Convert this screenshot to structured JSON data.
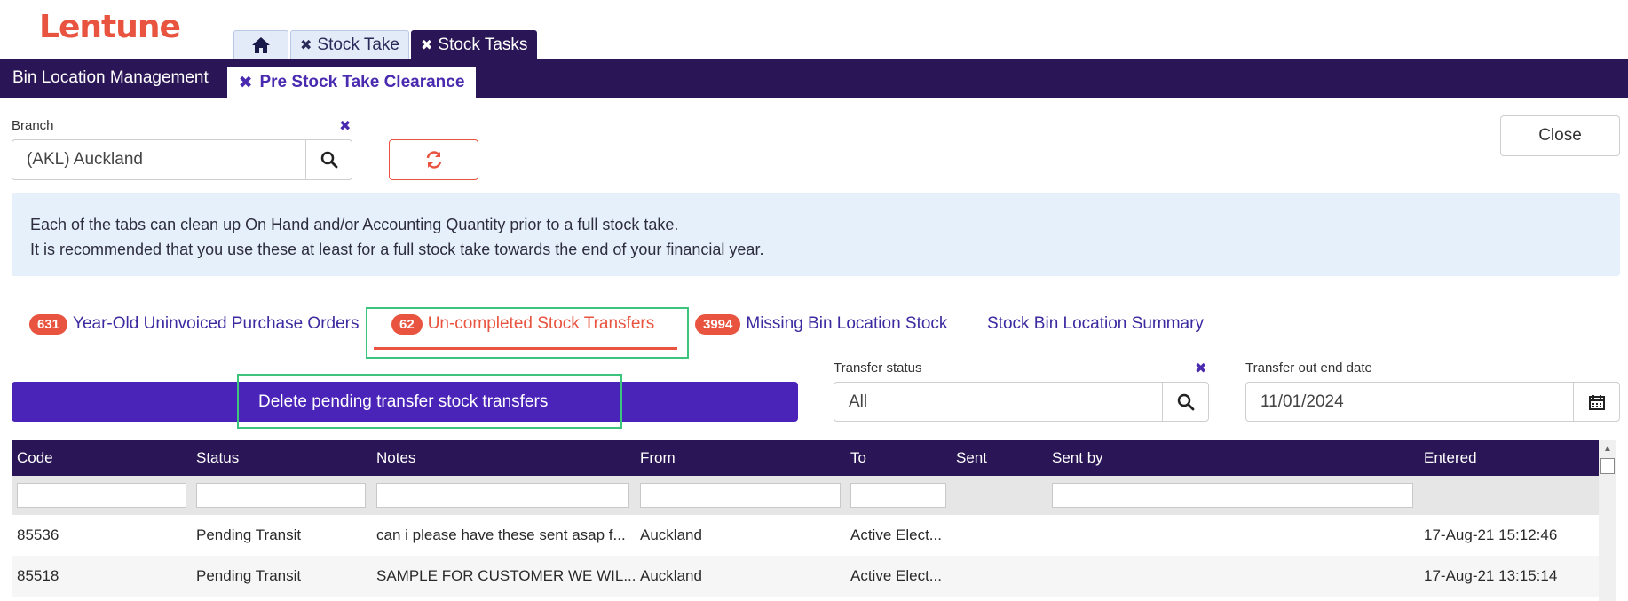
{
  "app": {
    "logo": "Lentune"
  },
  "app_tabs": [
    {
      "label": "",
      "icon": "home-icon"
    },
    {
      "label": "Stock Take",
      "closable": true
    },
    {
      "label": "Stock Tasks",
      "closable": true,
      "active": true
    }
  ],
  "sub_tabs": {
    "bin_location": "Bin Location Management",
    "pre_stock": "Pre Stock Take Clearance"
  },
  "branch": {
    "label": "Branch",
    "value": "(AKL) Auckland"
  },
  "close_label": "Close",
  "info": {
    "line1": "Each of the tabs can clean up On Hand and/or Accounting Quantity prior to a full stock take.",
    "line2": "It is recommended that you use these at least for a full stock take towards the end of your financial year."
  },
  "section_tabs": [
    {
      "count": "631",
      "label": "Year-Old Uninvoiced Purchase Orders"
    },
    {
      "count": "62",
      "label": "Un-completed Stock Transfers",
      "active": true
    },
    {
      "count": "3994",
      "label": "Missing Bin Location Stock"
    },
    {
      "count": "",
      "label": "Stock Bin Location Summary"
    }
  ],
  "delete_label": "Delete pending transfer stock transfers",
  "transfer_status": {
    "label": "Transfer status",
    "value": "All"
  },
  "transfer_out_end": {
    "label": "Transfer out end date",
    "value": "11/01/2024"
  },
  "table": {
    "columns": [
      "Code",
      "Status",
      "Notes",
      "From",
      "To",
      "Sent",
      "Sent by",
      "Entered"
    ],
    "rows": [
      [
        "85536",
        "Pending Transit",
        "can i please have these sent asap f...",
        "Auckland",
        "Active Elect...",
        "",
        "",
        "17-Aug-21 15:12:46"
      ],
      [
        "85518",
        "Pending Transit",
        "SAMPLE FOR CUSTOMER WE WIL...",
        "Auckland",
        "Active Elect...",
        "",
        "",
        "17-Aug-21 13:15:14"
      ]
    ]
  },
  "colors": {
    "brand": "#e8543f",
    "nav": "#2a1656",
    "primary": "#4a23b8",
    "link": "#3b2aa0",
    "highlight": "#3cc47c"
  }
}
